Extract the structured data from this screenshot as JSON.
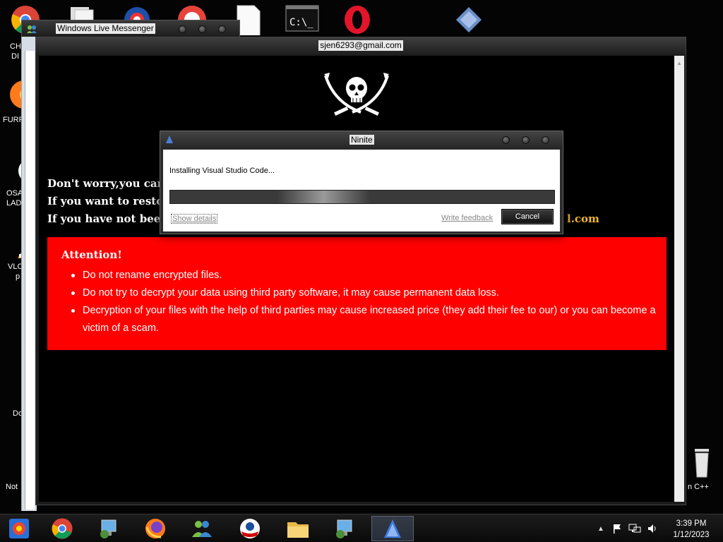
{
  "desktop": {
    "left_labels": [
      "CHI",
      "DI",
      "FURR",
      "OSA",
      "LAD",
      "VLC",
      "p",
      "Do",
      "Not"
    ],
    "right_label": "n C++"
  },
  "messenger": {
    "title": "Windows Live Messenger",
    "contact": "sjen6293@gmail.com"
  },
  "ransom_note": {
    "line1": "Don't worry,you can r",
    "line2": "If you want to restore",
    "line3": "If you have not been a",
    "email_fragment": "l.com",
    "attention_title": "Attention!",
    "bullets": [
      "Do not rename encrypted files.",
      "Do not try to decrypt your data using third party software, it may cause permanent data loss.",
      "Decryption of your files with the help of third parties may cause increased price (they add their fee to our) or you can become a victim of a scam."
    ]
  },
  "ninite": {
    "title": "Ninite",
    "status": "Installing Visual Studio Code...",
    "show_details": "Show details",
    "write_feedback": "Write feedback",
    "cancel": "Cancel"
  },
  "taskbar": {
    "time": "3:39 PM",
    "date": "1/12/2023",
    "items": [
      "ninite",
      "chrome",
      "remote-desktop",
      "firefox",
      "network-users",
      "obama-app",
      "file-explorer",
      "remote-desktop-2",
      "ninite-active"
    ]
  }
}
